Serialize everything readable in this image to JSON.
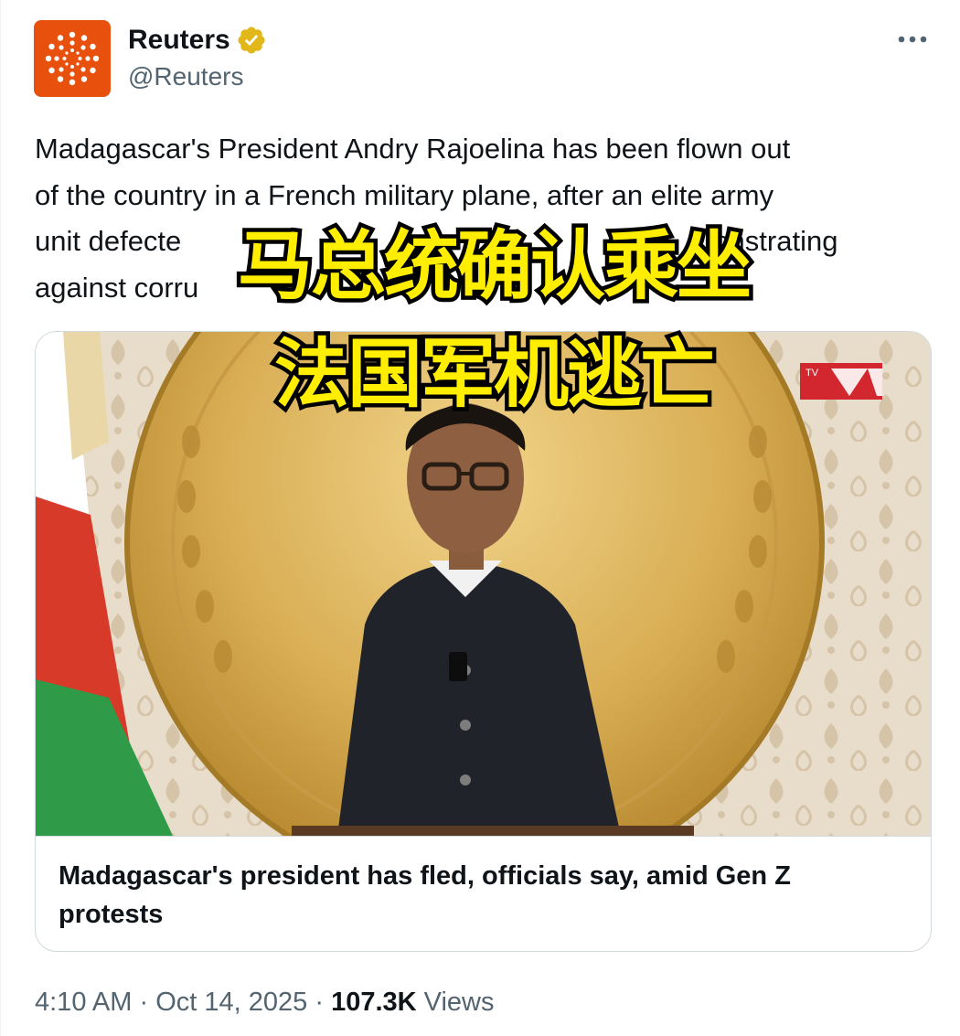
{
  "author": {
    "display_name": "Reuters",
    "handle": "@Reuters",
    "verified_icon": "gold-verified-badge-icon",
    "avatar_icon": "reuters-dotted-circle-logo"
  },
  "tweet": {
    "text_lines": [
      "Madagascar's President Andry Rajoelina has been flown out",
      "of the country in a French military plane, after an elite army",
      "unit defecte",
      "against corru"
    ],
    "line3_right": "onstrating"
  },
  "overlay": {
    "line1": "马总统确认乘坐",
    "line2": "法国军机逃亡"
  },
  "card": {
    "title": "Madagascar's president has fled, officials say, amid Gen Z protests",
    "image_desc_icon": "news-photo-president-speech",
    "tv_logo": "TV"
  },
  "footer": {
    "time": "4:10 AM",
    "separator": "·",
    "date": "Oct 14, 2025",
    "views_count": "107.3K",
    "views_label": "Views"
  },
  "colors": {
    "text_primary": "#0f1419",
    "text_secondary": "#536471",
    "avatar_bg": "#e8500e",
    "border": "#cfd9de",
    "overlay_text": "#ffee00",
    "verified_gold": "#e2b719"
  }
}
